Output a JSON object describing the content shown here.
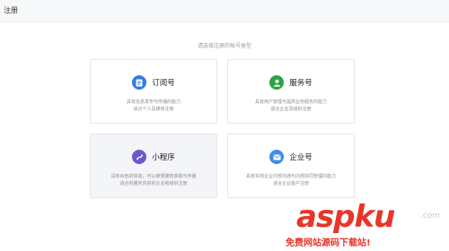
{
  "header": {
    "title": "注册"
  },
  "prompt": "请选择注册的帐号类型",
  "colors": {
    "subscription": "#2f7de1",
    "service": "#2ba245",
    "miniprogram": "#6e58c8",
    "enterprise": "#3a8fe8",
    "watermark": "#e8352a"
  },
  "cards": [
    {
      "title": "订阅号",
      "icon": "document-icon",
      "desc": [
        "具有信息发布与传播的能力",
        "适合个人及媒体注册"
      ]
    },
    {
      "title": "服务号",
      "icon": "user-icon",
      "desc": [
        "具有用户管理与提供业务服务的能力",
        "适合企业及组织注册"
      ]
    },
    {
      "title": "小程序",
      "icon": "miniprogram-icon",
      "desc": [
        "具有出色的体验，可以被便捷地获取与传播",
        "适合有服务内容的企业和组织注册"
      ]
    },
    {
      "title": "企业号",
      "icon": "mail-icon",
      "desc": [
        "具有实现企业内部沟通与内部协同管理的能力",
        "适合企业客户注册"
      ]
    }
  ],
  "watermark": {
    "brand": "aspku",
    "suffix": ".com",
    "tagline": "免费网站源码下载站!"
  }
}
